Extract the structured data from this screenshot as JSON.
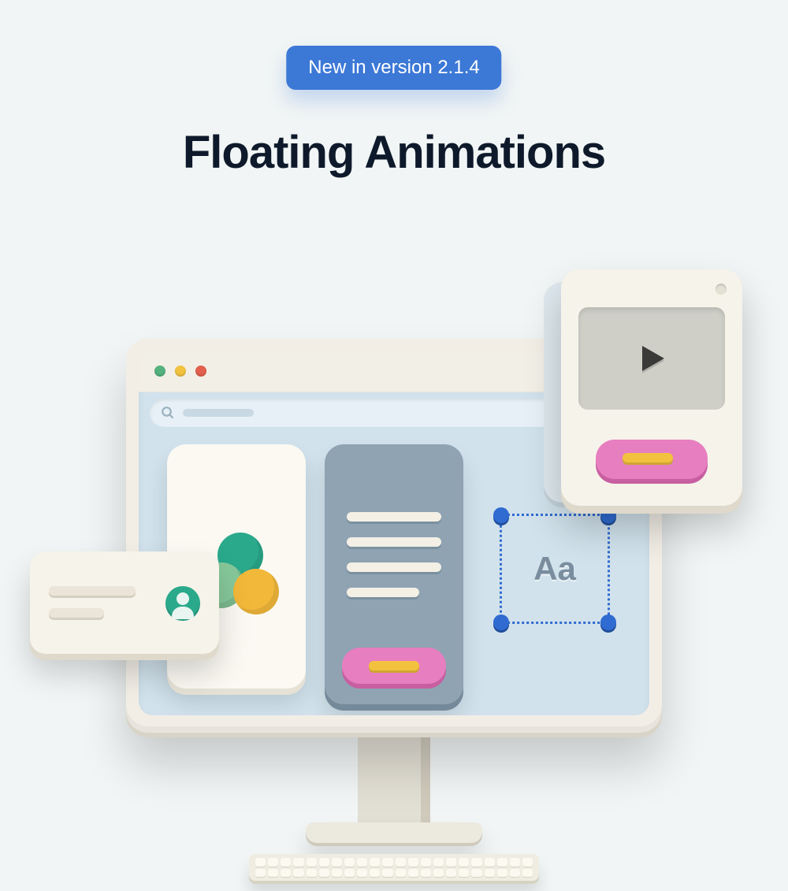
{
  "badge": {
    "text": "New in version 2.1.4"
  },
  "title": "Floating Animations",
  "illustration": {
    "type_sample": "Aa",
    "traffic_lights": [
      "green",
      "yellow",
      "red"
    ],
    "icons": {
      "search": "search-icon",
      "play": "play-icon",
      "avatar": "avatar-icon"
    },
    "accent_colors": {
      "teal": "#2aa98b",
      "green": "#86c89a",
      "gold": "#f1b83a",
      "pink": "#e77ec0",
      "blue": "#2f6bd0"
    }
  }
}
